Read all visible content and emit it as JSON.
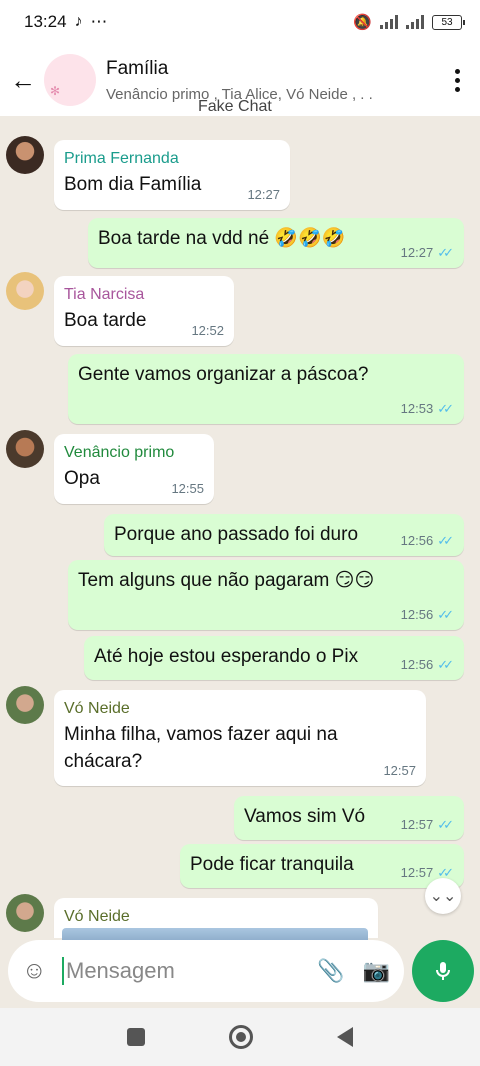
{
  "statusbar": {
    "time": "13:24",
    "extra": "⋯",
    "battery": "53"
  },
  "header": {
    "title": "Família",
    "subtitle": "Venâncio primo , Tia Alice, Vó Neide , . .",
    "back_icon": "←"
  },
  "watermark": "Fake Chat",
  "messages": [
    {
      "type": "in",
      "sender": "Prima Fernanda",
      "sender_color": "#1a9c8c",
      "text": "Bom dia Família",
      "time": "12:27"
    },
    {
      "type": "out",
      "text": "Boa tarde na vdd né 🤣🤣🤣",
      "time": "12:27"
    },
    {
      "type": "in",
      "sender": "Tia Narcisa",
      "sender_color": "#a8569c",
      "text": "Boa tarde",
      "time": "12:52"
    },
    {
      "type": "out",
      "text": "Gente vamos organizar a páscoa?",
      "time": "12:53"
    },
    {
      "type": "in",
      "sender": "Venâncio primo",
      "sender_color": "#218a3d",
      "text": "Opa",
      "time": "12:55"
    },
    {
      "type": "out",
      "text": "Porque ano passado foi duro",
      "time": "12:56"
    },
    {
      "type": "out",
      "text": "Tem alguns que não pagaram 😏😏",
      "time": "12:56"
    },
    {
      "type": "out",
      "text": "Até hoje estou esperando o Pix",
      "time": "12:56"
    },
    {
      "type": "in",
      "sender": "Vó Neide",
      "sender_color": "#5a6e2a",
      "text_line1": "Minha filha, vamos fazer aqui na",
      "text_line2": "chácara?",
      "time": "12:57"
    },
    {
      "type": "out",
      "text": "Vamos sim Vó",
      "time": "12:57"
    },
    {
      "type": "out",
      "text": "Pode ficar tranquila",
      "time": "12:57"
    },
    {
      "type": "in",
      "sender": "Vó Neide",
      "sender_color": "#5a6e2a"
    }
  ],
  "input": {
    "placeholder": "Mensagem"
  },
  "colors": {
    "outgoing": "#d9fdd3",
    "incoming": "#ffffff",
    "accent": "#1daa61",
    "background": "#efeae2"
  }
}
